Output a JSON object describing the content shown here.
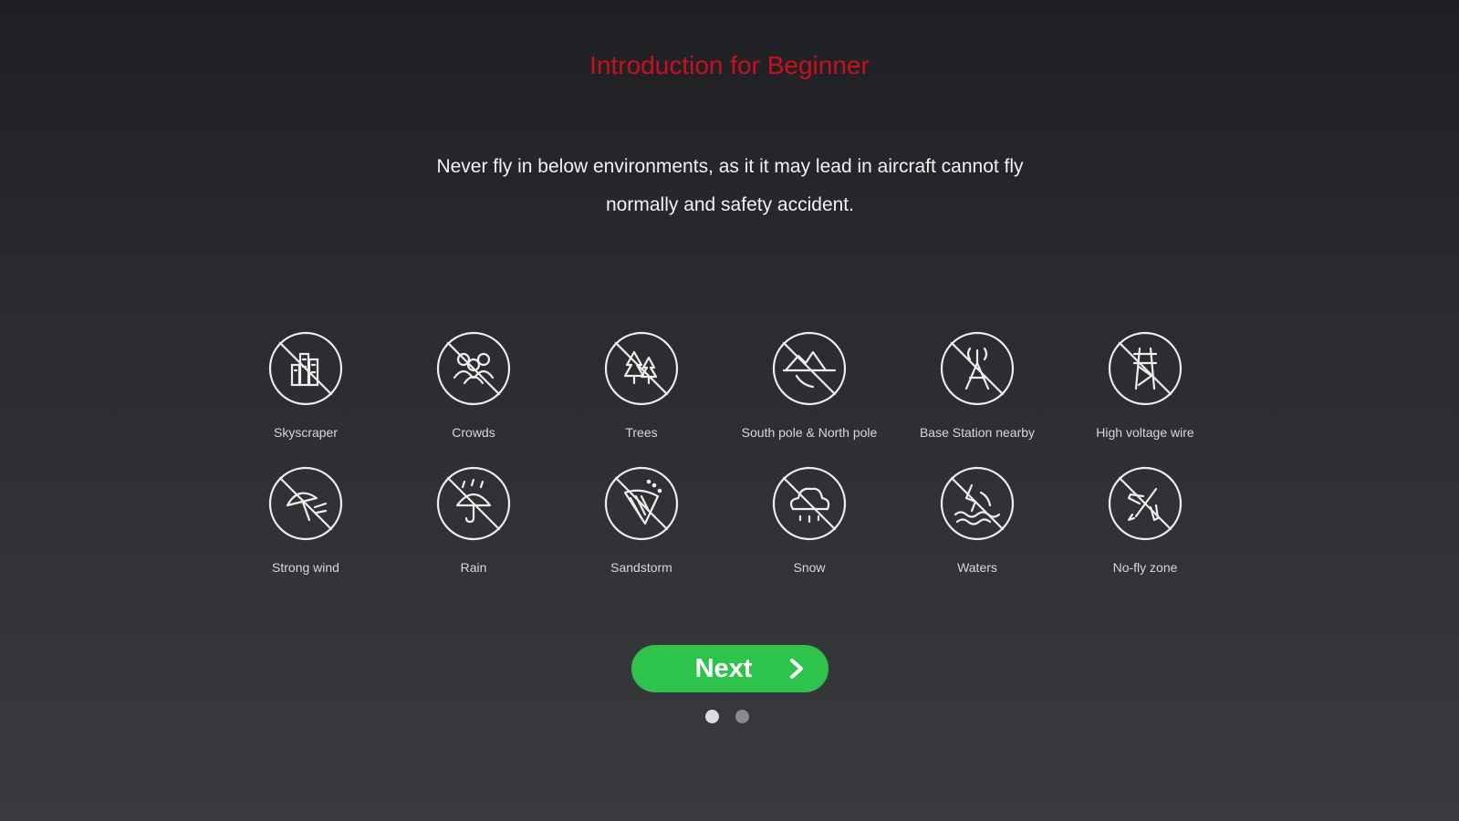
{
  "intro": {
    "title": "Introduction for Beginner",
    "subtitle_line1": "Never fly in below environments, as it it may lead in aircraft cannot fly",
    "subtitle_line2": "normally and safety accident."
  },
  "hazards": [
    {
      "label": "Skyscraper",
      "icon": "skyscraper-icon"
    },
    {
      "label": "Crowds",
      "icon": "crowds-icon"
    },
    {
      "label": "Trees",
      "icon": "trees-icon"
    },
    {
      "label": "South pole & North pole",
      "icon": "mountain-pole-icon"
    },
    {
      "label": "Base Station nearby",
      "icon": "base-station-icon"
    },
    {
      "label": "High voltage wire",
      "icon": "high-voltage-tower-icon"
    },
    {
      "label": "Strong wind",
      "icon": "strong-wind-icon"
    },
    {
      "label": "Rain",
      "icon": "rain-umbrella-icon"
    },
    {
      "label": "Sandstorm",
      "icon": "sandstorm-icon"
    },
    {
      "label": "Snow",
      "icon": "snow-cloud-icon"
    },
    {
      "label": "Waters",
      "icon": "waters-icon"
    },
    {
      "label": "No-fly zone",
      "icon": "no-fly-zone-icon"
    }
  ],
  "next_button": {
    "label": "Next",
    "icon": "chevron-right-icon"
  },
  "pagination": {
    "total": 2,
    "current": 1
  },
  "colors": {
    "title": "#c8101e",
    "button": "#2ec44c",
    "icon_stroke": "#eeeeee"
  }
}
